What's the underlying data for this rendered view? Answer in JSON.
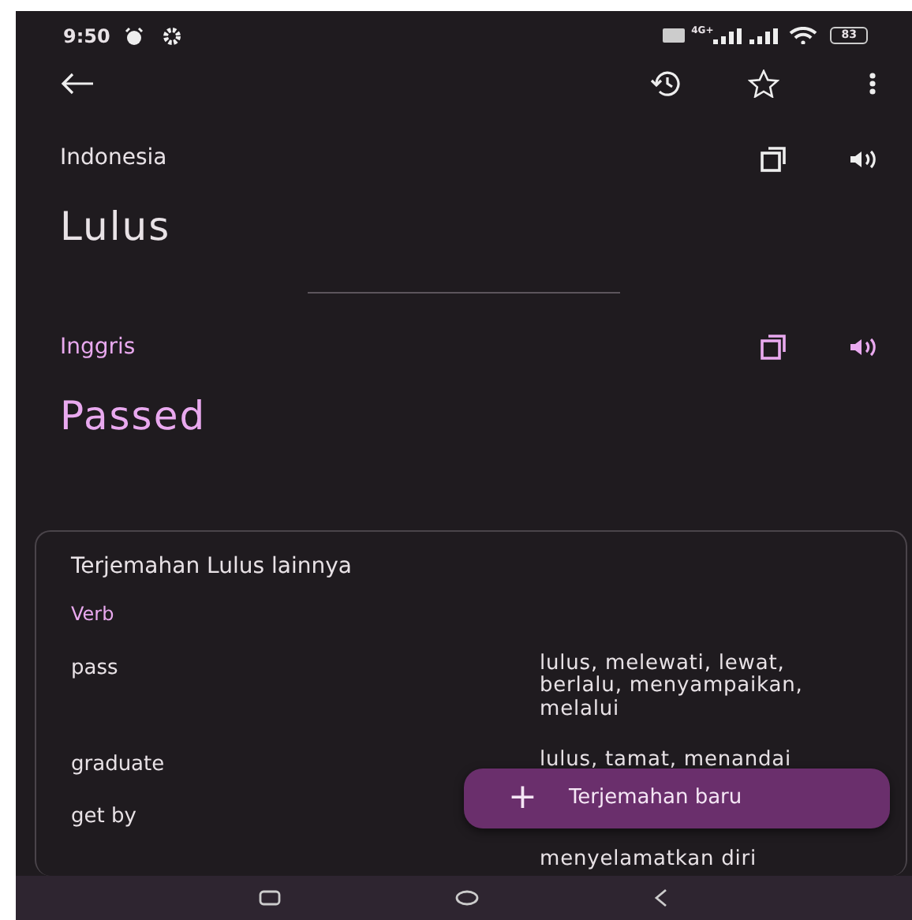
{
  "status_bar": {
    "time": "9:50",
    "network": "4G+",
    "battery": "83"
  },
  "source": {
    "language": "Indonesia",
    "text": "Lulus"
  },
  "target": {
    "language": "Inggris",
    "text": "Passed"
  },
  "other_translations": {
    "title": "Terjemahan Lulus lainnya",
    "groups": [
      {
        "part_of_speech": "Verb",
        "entries": [
          {
            "word": "pass",
            "translations": "lulus, melewati, lewat, berlalu, menyampaikan, melalui"
          },
          {
            "word": "graduate",
            "translations": "lulus, tamat, menandai"
          },
          {
            "word": "get by",
            "translations": "menyelamatkan diri"
          }
        ]
      }
    ]
  },
  "fab": {
    "icon": "+",
    "label": "Terjemahan baru"
  }
}
